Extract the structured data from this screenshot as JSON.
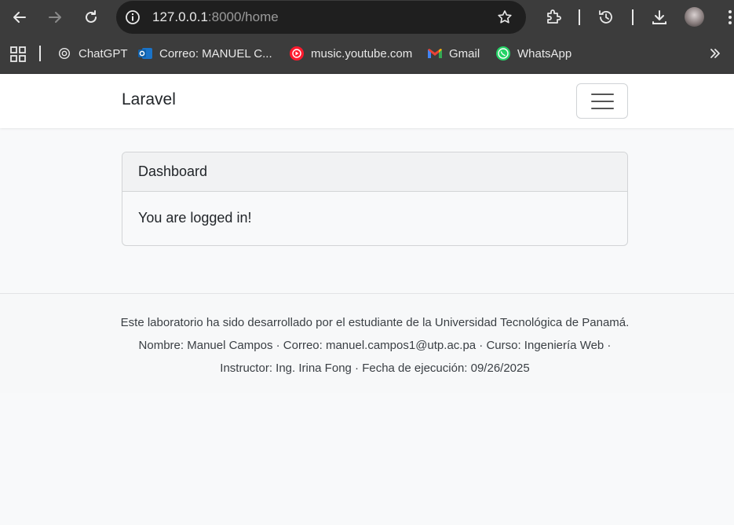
{
  "browser": {
    "url_host": "127.0.0.1",
    "url_rest": ":8000/home",
    "bookmarks": [
      {
        "label": "ChatGPT",
        "icon": "chatgpt-icon"
      },
      {
        "label": "Correo: MANUEL C...",
        "icon": "outlook-icon"
      },
      {
        "label": "music.youtube.com",
        "icon": "youtube-music-icon"
      },
      {
        "label": "Gmail",
        "icon": "gmail-icon"
      },
      {
        "label": "WhatsApp",
        "icon": "whatsapp-icon"
      }
    ]
  },
  "navbar": {
    "brand": "Laravel"
  },
  "card": {
    "header": "Dashboard",
    "body": "You are logged in!"
  },
  "footer": {
    "text": "Este laboratorio ha sido desarrollado por el estudiante de la Universidad Tecnológica de Panamá. Nombre: Manuel Campos · Correo: manuel.campos1@utp.ac.pa · Curso: Ingeniería Web · Instructor: Ing. Irina Fong · Fecha de ejecución: 09/26/2025"
  },
  "colors": {
    "chrome_bg": "#3c3c3c",
    "omnibox_bg": "#1f1f1f",
    "page_bg": "#f8f9fa",
    "text": "#212529"
  }
}
